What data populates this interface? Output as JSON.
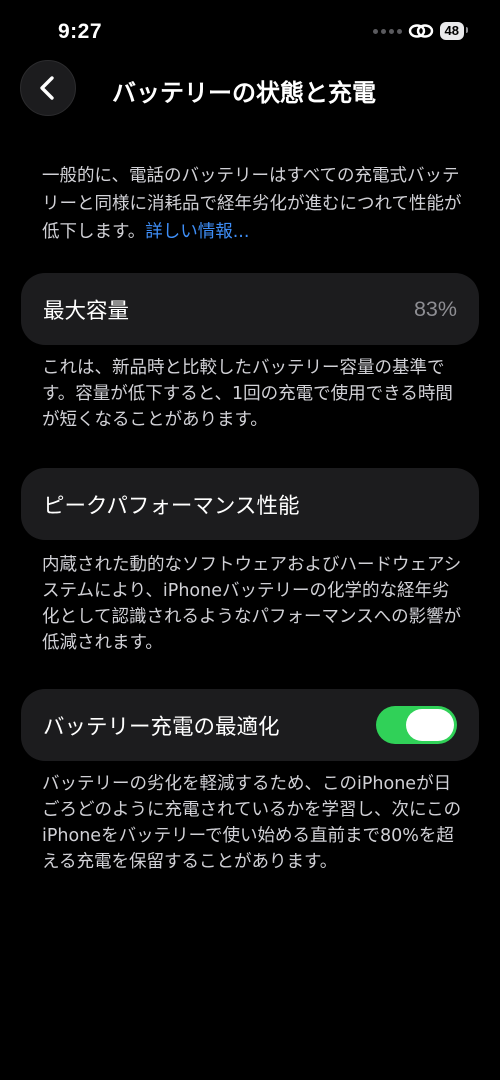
{
  "status_bar": {
    "time": "9:27",
    "battery_level": "48",
    "icons": [
      "signal-dots-icon",
      "link-icon",
      "battery-icon"
    ]
  },
  "nav": {
    "back_icon": "chevron-left-icon",
    "title": "バッテリーの状態と充電"
  },
  "intro": {
    "text": "一般的に、電話のバッテリーはすべての充電式バッテリーと同様に消耗品で経年劣化が進むにつれて性能が低下します。",
    "link": "詳しい情報..."
  },
  "max_capacity": {
    "label": "最大容量",
    "value": "83%",
    "description": "これは、新品時と比較したバッテリー容量の基準です。容量が低下すると、1回の充電で使用できる時間が短くなることがあります。"
  },
  "peak_performance": {
    "label": "ピークパフォーマンス性能",
    "description": "内蔵された動的なソフトウェアおよびハードウェアシステムにより、iPhoneバッテリーの化学的な経年劣化として認識されるようなパフォーマンスへの影響が低減されます。"
  },
  "optimized_charging": {
    "label": "バッテリー充電の最適化",
    "enabled": true,
    "description": "バッテリーの劣化を軽減するため、このiPhoneが日ごろどのように充電されているかを学習し、次にこのiPhoneをバッテリーで使い始める直前まで80%を超える充電を保留することがあります。"
  },
  "colors": {
    "background": "#000000",
    "card": "#1c1c1e",
    "link": "#3e8ef7",
    "toggle_on": "#30d158",
    "secondary_text": "#8e8e93"
  }
}
